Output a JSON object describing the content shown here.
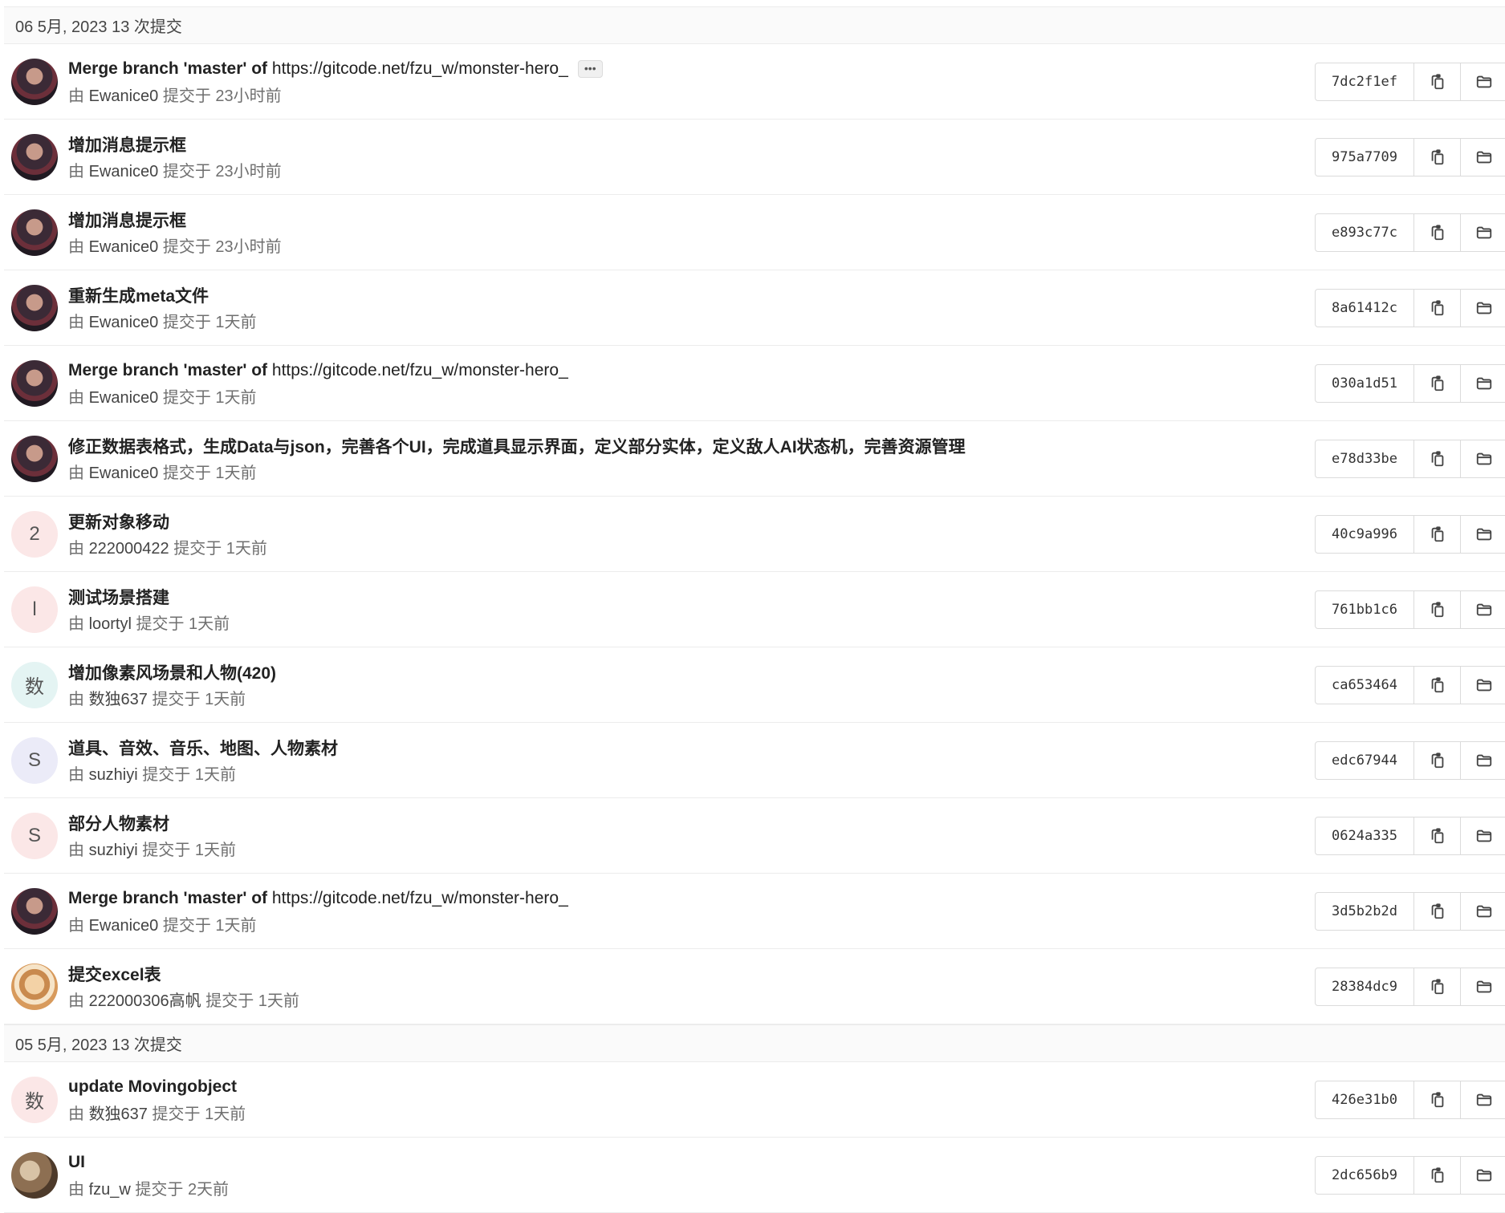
{
  "groups": [
    {
      "header": "06 5月, 2023 13 次提交",
      "commits": [
        {
          "title_bold": "Merge branch 'master' of ",
          "title_plain": "https://gitcode.net/fzu_w/monster-hero_",
          "has_more": true,
          "by": "由",
          "author": "Ewanice0",
          "verb": "提交于",
          "time": "23小时前",
          "sha": "7dc2f1ef",
          "avatar": {
            "type": "image",
            "style": "img-a"
          }
        },
        {
          "title_bold": "增加消息提示框",
          "title_plain": "",
          "has_more": false,
          "by": "由",
          "author": "Ewanice0",
          "verb": "提交于",
          "time": "23小时前",
          "sha": "975a7709",
          "avatar": {
            "type": "image",
            "style": "img-a"
          }
        },
        {
          "title_bold": "增加消息提示框",
          "title_plain": "",
          "has_more": false,
          "by": "由",
          "author": "Ewanice0",
          "verb": "提交于",
          "time": "23小时前",
          "sha": "e893c77c",
          "avatar": {
            "type": "image",
            "style": "img-a"
          }
        },
        {
          "title_bold": "重新生成meta文件",
          "title_plain": "",
          "has_more": false,
          "by": "由",
          "author": "Ewanice0",
          "verb": "提交于",
          "time": "1天前",
          "sha": "8a61412c",
          "avatar": {
            "type": "image",
            "style": "img-a"
          }
        },
        {
          "title_bold": "Merge branch 'master' of ",
          "title_plain": "https://gitcode.net/fzu_w/monster-hero_",
          "has_more": false,
          "by": "由",
          "author": "Ewanice0",
          "verb": "提交于",
          "time": "1天前",
          "sha": "030a1d51",
          "avatar": {
            "type": "image",
            "style": "img-a"
          }
        },
        {
          "title_bold": "修正数据表格式，生成Data与json，完善各个UI，完成道具显示界面，定义部分实体，定义敌人AI状态机，完善资源管理",
          "title_plain": "",
          "has_more": false,
          "by": "由",
          "author": "Ewanice0",
          "verb": "提交于",
          "time": "1天前",
          "sha": "e78d33be",
          "avatar": {
            "type": "image",
            "style": "img-a"
          }
        },
        {
          "title_bold": "更新对象移动",
          "title_plain": "",
          "has_more": false,
          "by": "由",
          "author": "222000422",
          "verb": "提交于",
          "time": "1天前",
          "sha": "40c9a996",
          "avatar": {
            "type": "letter",
            "letter": "2",
            "style": "c-pink"
          }
        },
        {
          "title_bold": "测试场景搭建",
          "title_plain": "",
          "has_more": false,
          "by": "由",
          "author": "loortyl",
          "verb": "提交于",
          "time": "1天前",
          "sha": "761bb1c6",
          "avatar": {
            "type": "letter",
            "letter": "l",
            "style": "c-pink"
          }
        },
        {
          "title_bold": "增加像素风场景和人物(420)",
          "title_plain": "",
          "has_more": false,
          "by": "由",
          "author": "数独637",
          "verb": "提交于",
          "time": "1天前",
          "sha": "ca653464",
          "avatar": {
            "type": "letter",
            "letter": "数",
            "style": "c-teal"
          }
        },
        {
          "title_bold": "道具、音效、音乐、地图、人物素材",
          "title_plain": "",
          "has_more": false,
          "by": "由",
          "author": "suzhiyi",
          "verb": "提交于",
          "time": "1天前",
          "sha": "edc67944",
          "avatar": {
            "type": "letter",
            "letter": "S",
            "style": "c-lav"
          }
        },
        {
          "title_bold": "部分人物素材",
          "title_plain": "",
          "has_more": false,
          "by": "由",
          "author": "suzhiyi",
          "verb": "提交于",
          "time": "1天前",
          "sha": "0624a335",
          "avatar": {
            "type": "letter",
            "letter": "S",
            "style": "c-pink"
          }
        },
        {
          "title_bold": "Merge branch 'master' of ",
          "title_plain": "https://gitcode.net/fzu_w/monster-hero_",
          "has_more": false,
          "by": "由",
          "author": "Ewanice0",
          "verb": "提交于",
          "time": "1天前",
          "sha": "3d5b2b2d",
          "avatar": {
            "type": "image",
            "style": "img-a"
          }
        },
        {
          "title_bold": "提交excel表",
          "title_plain": "",
          "has_more": false,
          "by": "由",
          "author": "222000306高帆",
          "verb": "提交于",
          "time": "1天前",
          "sha": "28384dc9",
          "avatar": {
            "type": "image",
            "style": "img-b"
          }
        }
      ]
    },
    {
      "header": "05 5月, 2023 13 次提交",
      "commits": [
        {
          "title_bold": "update Movingobject",
          "title_plain": "",
          "has_more": false,
          "by": "由",
          "author": "数独637",
          "verb": "提交于",
          "time": "1天前",
          "sha": "426e31b0",
          "avatar": {
            "type": "letter",
            "letter": "数",
            "style": "c-pink"
          }
        },
        {
          "title_bold": "UI",
          "title_plain": "",
          "has_more": false,
          "by": "由",
          "author": "fzu_w",
          "verb": "提交于",
          "time": "2天前",
          "sha": "2dc656b9",
          "avatar": {
            "type": "image",
            "style": "img-c"
          }
        }
      ]
    }
  ],
  "more_label": "•••",
  "icons": {
    "copy": "copy-icon",
    "browse": "folder-icon"
  }
}
